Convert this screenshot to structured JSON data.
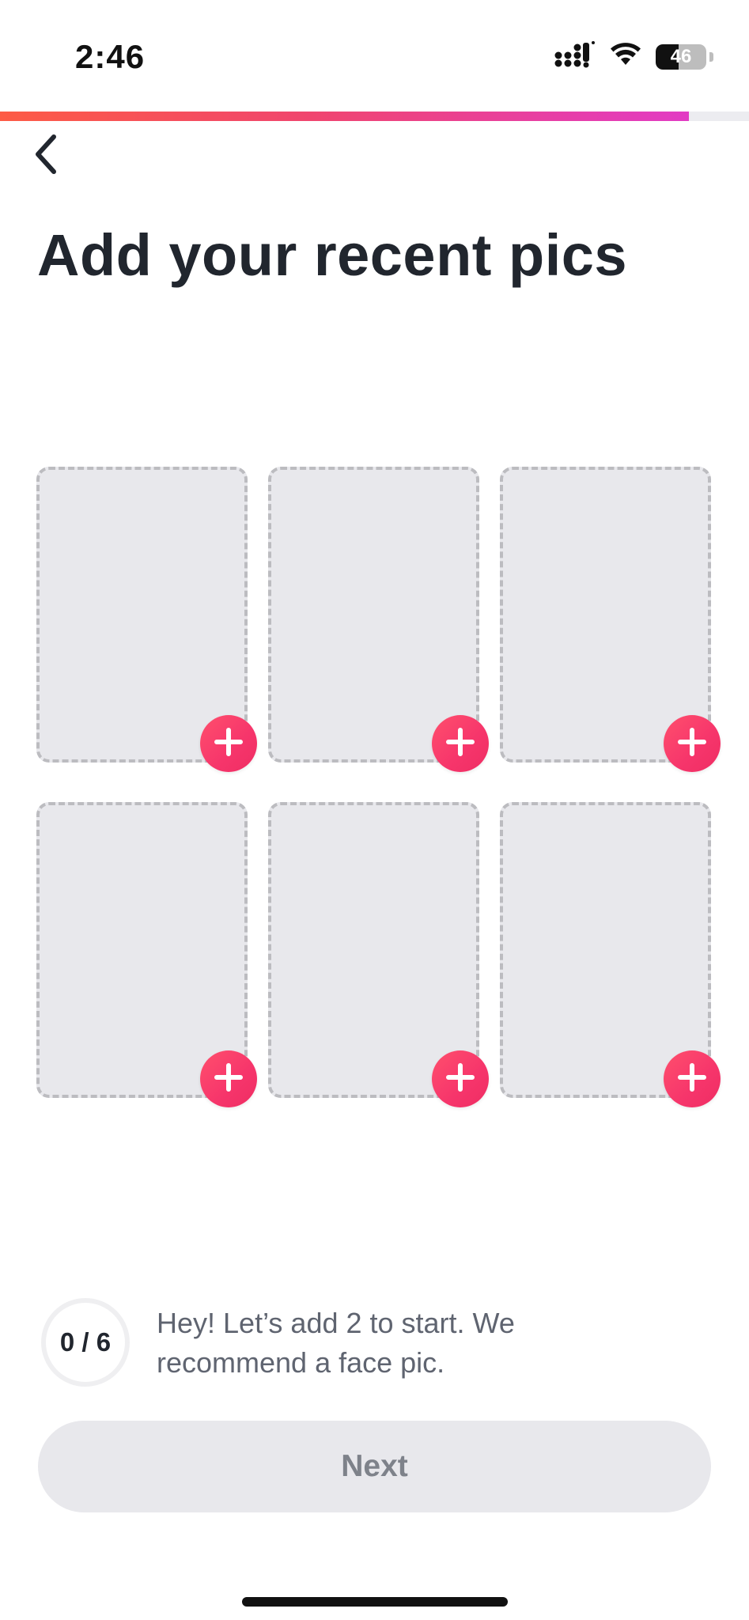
{
  "status_bar": {
    "time": "2:46",
    "battery_level": "46",
    "battery_fraction": 0.46
  },
  "progress": {
    "fraction": 0.92
  },
  "title": "Add your recent pics",
  "photo_slots": [
    {
      "label": "photo-slot-1"
    },
    {
      "label": "photo-slot-2"
    },
    {
      "label": "photo-slot-3"
    },
    {
      "label": "photo-slot-4"
    },
    {
      "label": "photo-slot-5"
    },
    {
      "label": "photo-slot-6"
    }
  ],
  "counter": {
    "text": "0 / 6"
  },
  "hint": "Hey! Let’s add 2 to start. We recommend a face pic.",
  "next_label": "Next",
  "colors": {
    "accent": "#f6356b",
    "progress_start": "#fd5b45",
    "progress_end": "#e23bc4",
    "slot_fill": "#e8e8ec",
    "title_text": "#21262e"
  },
  "icons": {
    "back": "chevron-left-icon",
    "add": "plus-icon",
    "signal": "cellular-signal-icon",
    "wifi": "wifi-icon",
    "battery": "battery-icon"
  }
}
